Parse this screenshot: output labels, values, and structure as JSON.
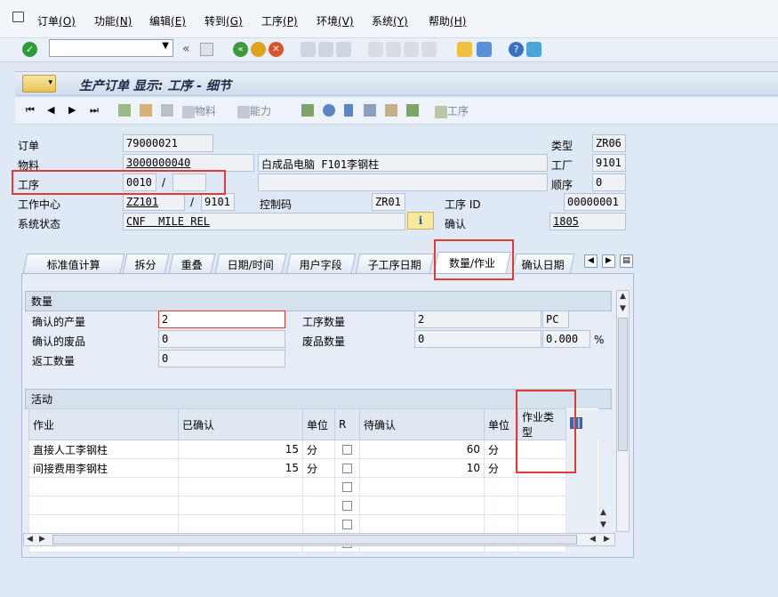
{
  "menubar": {
    "items": [
      {
        "label": "订单",
        "hotkey": "(O)"
      },
      {
        "label": "功能",
        "hotkey": "(N)"
      },
      {
        "label": "编辑",
        "hotkey": "(E)"
      },
      {
        "label": "转到",
        "hotkey": "(G)"
      },
      {
        "label": "工序",
        "hotkey": "(P)"
      },
      {
        "label": "环境",
        "hotkey": "(V)"
      },
      {
        "label": "系统",
        "hotkey": "(Y)"
      },
      {
        "label": "帮助",
        "hotkey": "(H)"
      }
    ]
  },
  "command_field": {
    "value": ""
  },
  "title": "生产订单 显示: 工序 - 细节",
  "app_toolbar": {
    "material_label": "物料",
    "capacity_label": "能力",
    "operation_label": "工序"
  },
  "header": {
    "order_label": "订单",
    "order_value": "79000021",
    "type_label": "类型",
    "type_value": "ZR06",
    "material_label": "物料",
    "material_value": "3000000040",
    "material_desc": "白成品电脑 F101李钢柱",
    "plant_label": "工厂",
    "plant_value": "9101",
    "operation_label": "工序",
    "operation_value": "0010",
    "sub_operation_value": "",
    "sequence_label": "顺序",
    "sequence_value": "0",
    "workcenter_label": "工作中心",
    "workcenter_value": "ZZ101",
    "workcenter_plant": "9101",
    "control_key_label": "控制码",
    "control_key_value": "ZR01",
    "operation_id_label": "工序 ID",
    "operation_id_value": "00000001",
    "system_status_label": "系统状态",
    "system_status_value": "CNF  MILE REL",
    "confirmation_label": "确认",
    "confirmation_value": "1805"
  },
  "tabs": [
    "标准值计算",
    "拆分",
    "重叠",
    "日期/时间",
    "用户字段",
    "子工序日期",
    "数量/作业",
    "确认日期"
  ],
  "quantities": {
    "section_title": "数量",
    "confirmed_yield_label": "确认的产量",
    "confirmed_yield_value": "2",
    "confirmed_scrap_label": "确认的废品",
    "confirmed_scrap_value": "0",
    "rework_label": "返工数量",
    "rework_value": "0",
    "operation_qty_label": "工序数量",
    "operation_qty_value": "2",
    "operation_qty_unit": "PC",
    "scrap_qty_label": "废品数量",
    "scrap_qty_value": "0",
    "scrap_pct_value": "0.000",
    "scrap_pct_unit": "%"
  },
  "activities": {
    "section_title": "活动",
    "columns": [
      "作业",
      "已确认",
      "单位",
      "R",
      "待确认",
      "单位",
      "作业类型"
    ],
    "rows": [
      {
        "activity": "直接人工李钢柱",
        "confirmed": "15",
        "unit": "分",
        "remaining": "60",
        "unit2": "分",
        "activity_type": ""
      },
      {
        "activity": "间接费用李钢柱",
        "confirmed": "15",
        "unit": "分",
        "remaining": "10",
        "unit2": "分",
        "activity_type": ""
      },
      {
        "activity": "",
        "confirmed": "",
        "unit": "",
        "remaining": "",
        "unit2": "",
        "activity_type": ""
      },
      {
        "activity": "",
        "confirmed": "",
        "unit": "",
        "remaining": "",
        "unit2": "",
        "activity_type": ""
      },
      {
        "activity": "",
        "confirmed": "",
        "unit": "",
        "remaining": "",
        "unit2": "",
        "activity_type": ""
      },
      {
        "activity": "",
        "confirmed": "",
        "unit": "",
        "remaining": "",
        "unit2": "",
        "activity_type": ""
      }
    ]
  }
}
